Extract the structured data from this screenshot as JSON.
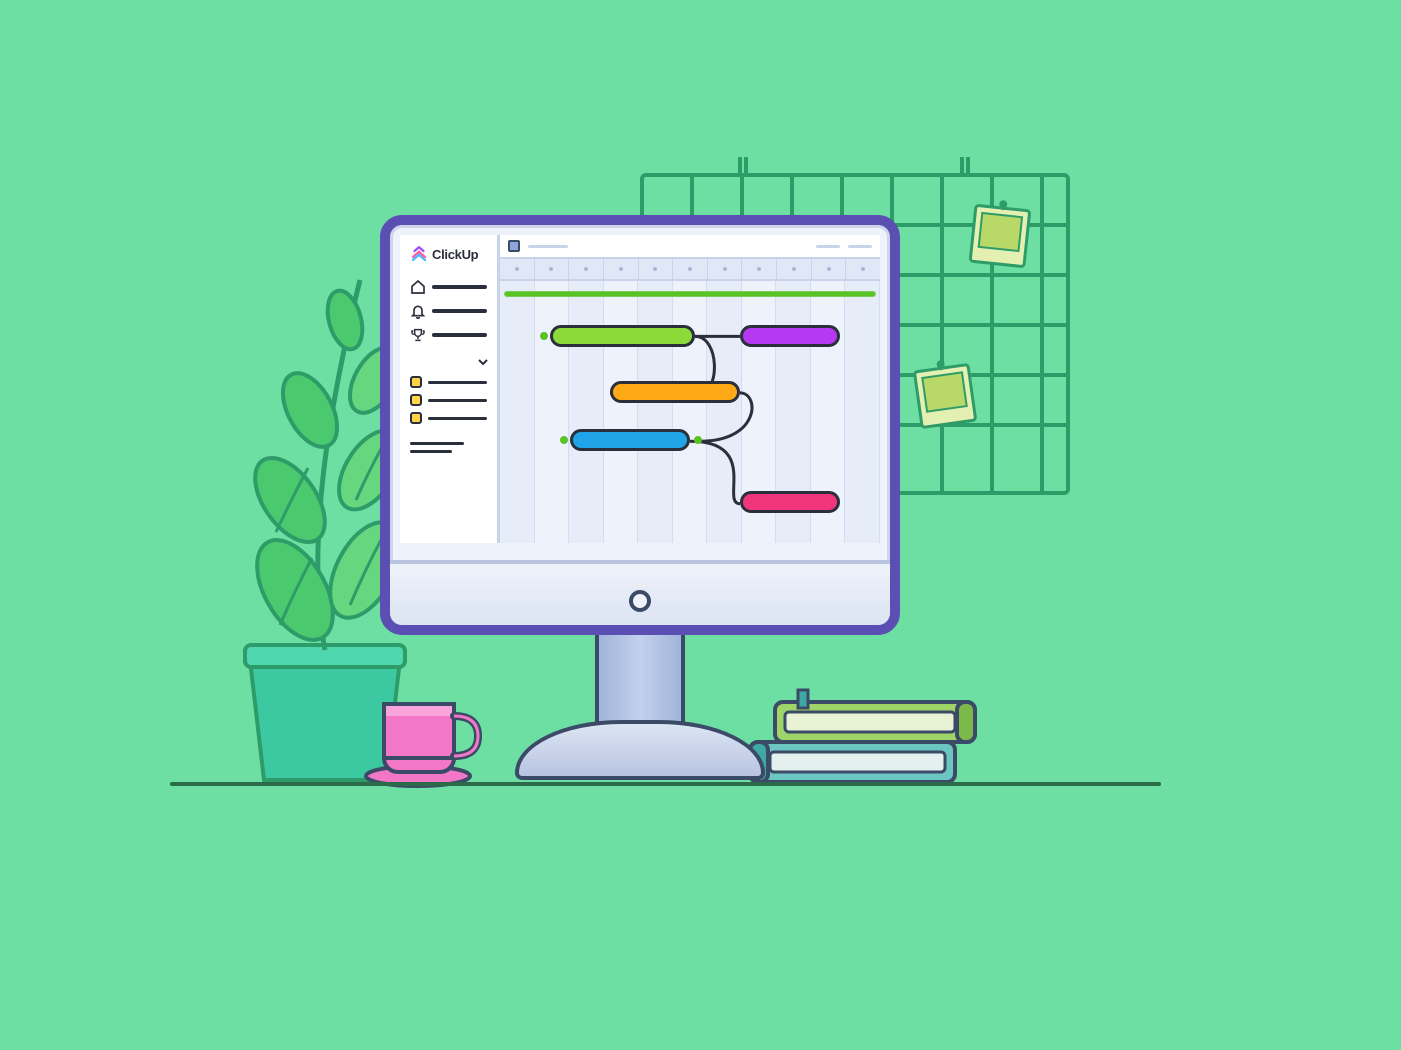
{
  "brand": {
    "name": "ClickUp"
  },
  "sidebar": {
    "nav": [
      {
        "icon": "home-icon"
      },
      {
        "icon": "bell-icon"
      },
      {
        "icon": "trophy-icon"
      }
    ],
    "tasks_count": 3
  },
  "gantt": {
    "columns": 11,
    "bars": [
      {
        "name": "bar-green",
        "color": "#8CD93A"
      },
      {
        "name": "bar-purple",
        "color": "#B538F2"
      },
      {
        "name": "bar-orange",
        "color": "#FFA917"
      },
      {
        "name": "bar-blue",
        "color": "#1FA4E8"
      },
      {
        "name": "bar-pink",
        "color": "#F0357D"
      }
    ]
  },
  "colors": {
    "background": "#6DDFA3",
    "monitor_frame": "#5B4FB3",
    "outline": "#2B2E3B"
  }
}
